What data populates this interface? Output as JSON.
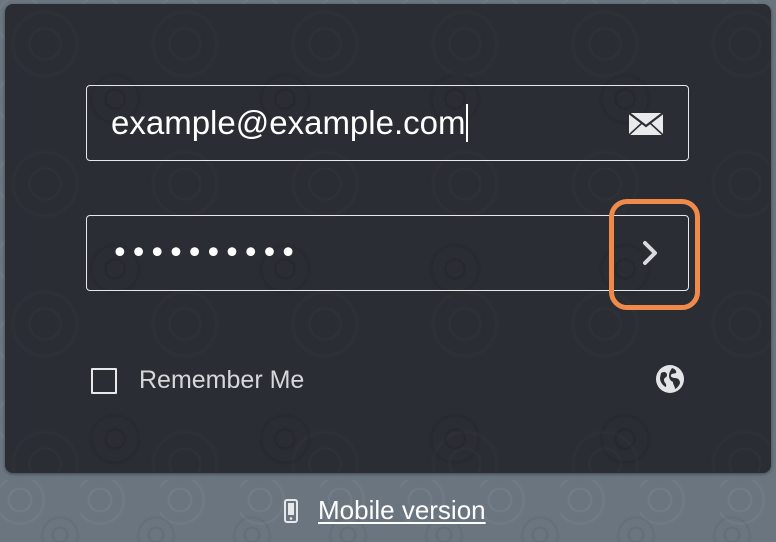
{
  "login": {
    "email_value": "example@example.com",
    "password_mask": "••••••••••",
    "remember_label": "Remember Me"
  },
  "footer": {
    "mobile_label": "Mobile version"
  },
  "icons": {
    "email": "envelope-icon",
    "submit": "chevron-right-icon",
    "language": "globe-icon",
    "mobile": "phone-icon"
  },
  "colors": {
    "panel": "#2a2d33",
    "backdrop": "#6b7580",
    "highlight": "#f08a4b",
    "field_border": "#e6e8ea"
  }
}
